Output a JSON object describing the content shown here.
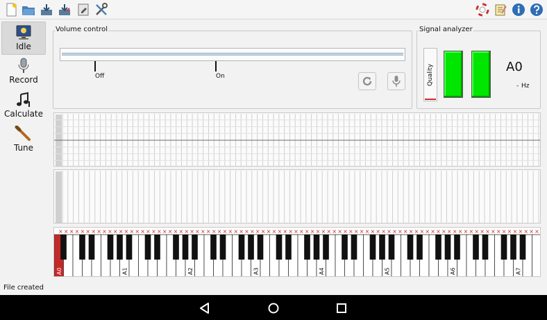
{
  "toolbar": {
    "left_icons": [
      "new-file-icon",
      "open-folder-icon",
      "save-icon",
      "save-as-icon",
      "edit-file-icon",
      "tools-icon"
    ],
    "right_icons": [
      "help-lifebuoy-icon",
      "notes-icon",
      "info-icon",
      "help-icon"
    ]
  },
  "modes": [
    {
      "label": "Idle",
      "icon": "monitor-icon",
      "active": true
    },
    {
      "label": "Record",
      "icon": "microphone-icon",
      "active": false
    },
    {
      "label": "Calculate",
      "icon": "music-notes-icon",
      "active": false
    },
    {
      "label": "Tune",
      "icon": "tuning-hammer-icon",
      "active": false
    }
  ],
  "volume": {
    "title": "Volume control",
    "off_label": "Off",
    "on_label": "On"
  },
  "analyzer": {
    "title": "Signal analyzer",
    "quality_label": "Quality",
    "note": "A0",
    "frequency": "-",
    "unit": "Hz",
    "meter_color": "#00e600"
  },
  "keyboard": {
    "white_keys": 52,
    "selected_key": "A0",
    "selected_color": "#c62828",
    "octave_labels": [
      "A0",
      "A1",
      "A2",
      "A3",
      "A4",
      "A5",
      "A6",
      "A7"
    ],
    "marker_glyph": "×",
    "marker_color": "#c62828"
  },
  "status": {
    "text": "File created"
  },
  "navbar": {
    "icons": [
      "back-icon",
      "home-icon",
      "recents-icon"
    ]
  }
}
